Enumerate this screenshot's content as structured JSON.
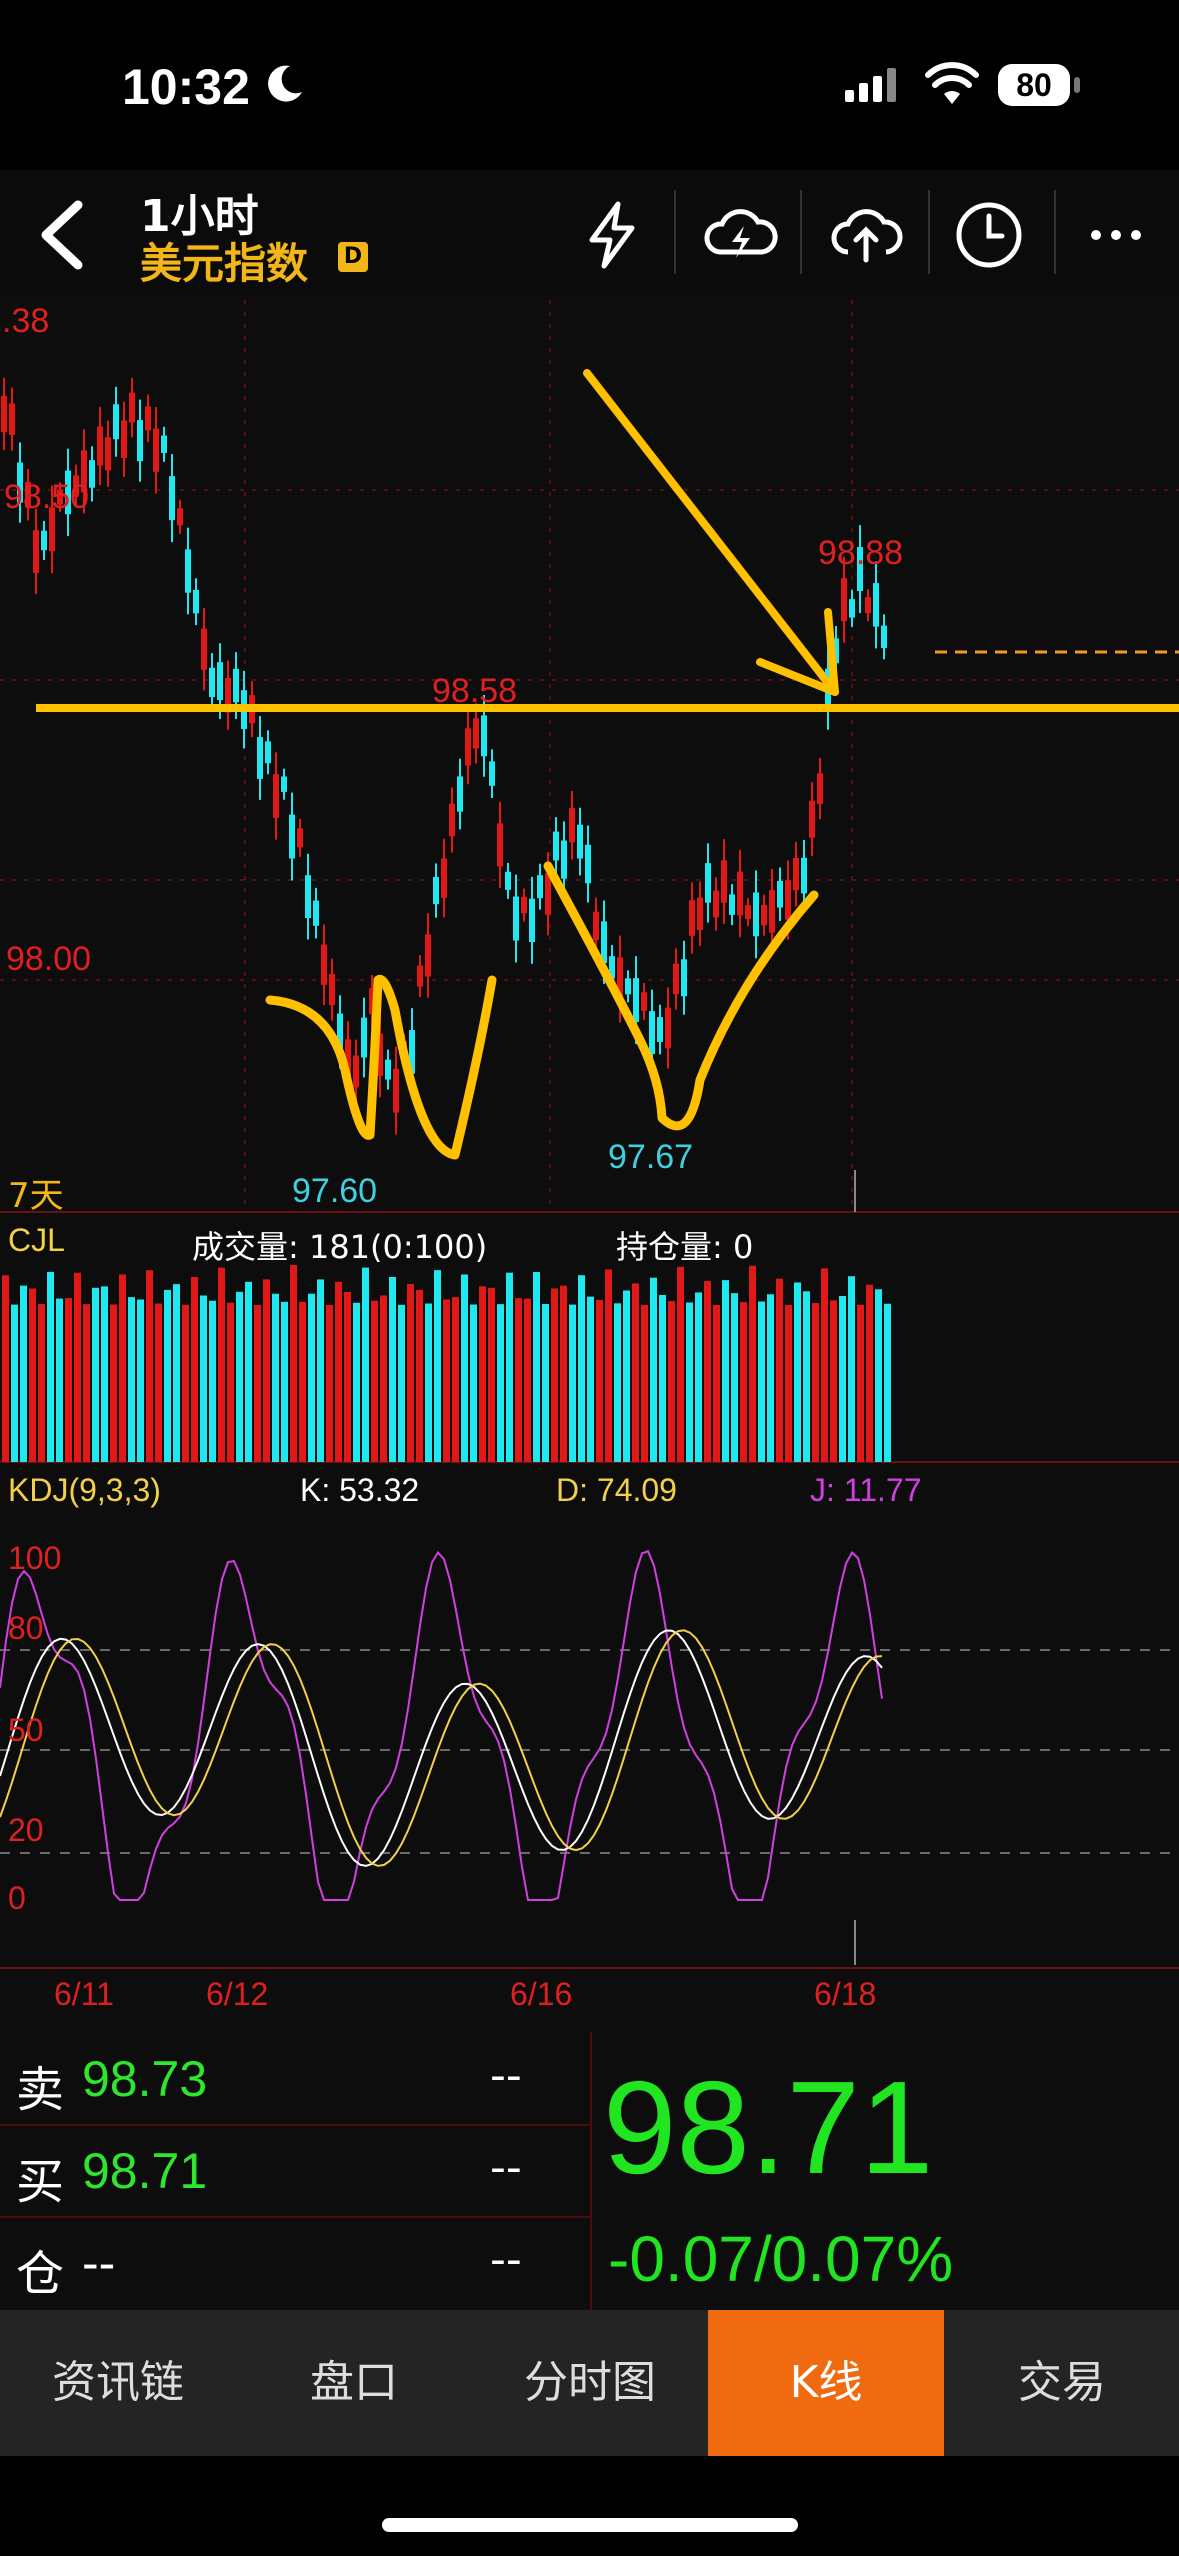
{
  "status_bar": {
    "time": "10:32",
    "battery": "80"
  },
  "header": {
    "period": "1小时",
    "instrument": "美元指数",
    "badge": "D"
  },
  "main_chart": {
    "price_labels": {
      "top_left": ".38",
      "upper_left": "98.50",
      "level_98": "98.00"
    },
    "annotations": {
      "high_right": "98.88",
      "mid_high": "98.58",
      "low_left": "97.60",
      "low_mid": "97.67"
    },
    "span_label": "7天"
  },
  "volume": {
    "name": "CJL",
    "turnover": "成交量: 181(0:100)",
    "open_interest": "持仓量: 0"
  },
  "kdj": {
    "name": "KDJ(9,3,3)",
    "k": "K: 53.32",
    "d": "D: 74.09",
    "j": "J: 11.77",
    "levels": [
      "100",
      "80",
      "50",
      "20",
      "0"
    ]
  },
  "dates": [
    "6/11",
    "6/12",
    "6/16",
    "6/18"
  ],
  "quote": {
    "sell_label": "卖",
    "sell_price": "98.73",
    "sell_qty": "--",
    "buy_label": "买",
    "buy_price": "98.71",
    "buy_qty": "--",
    "pos_label": "仓",
    "pos_value": "--",
    "pos_qty": "--",
    "last_price": "98.71",
    "change": "-0.07/0.07%"
  },
  "tabs": [
    "资讯链",
    "盘口",
    "分时图",
    "K线",
    "交易"
  ],
  "active_tab": "K线",
  "colors": {
    "up": "#e01818",
    "down": "#1fe8f0",
    "accent": "#f2b619",
    "green": "#21e521",
    "tab_active": "#f06a10"
  }
}
